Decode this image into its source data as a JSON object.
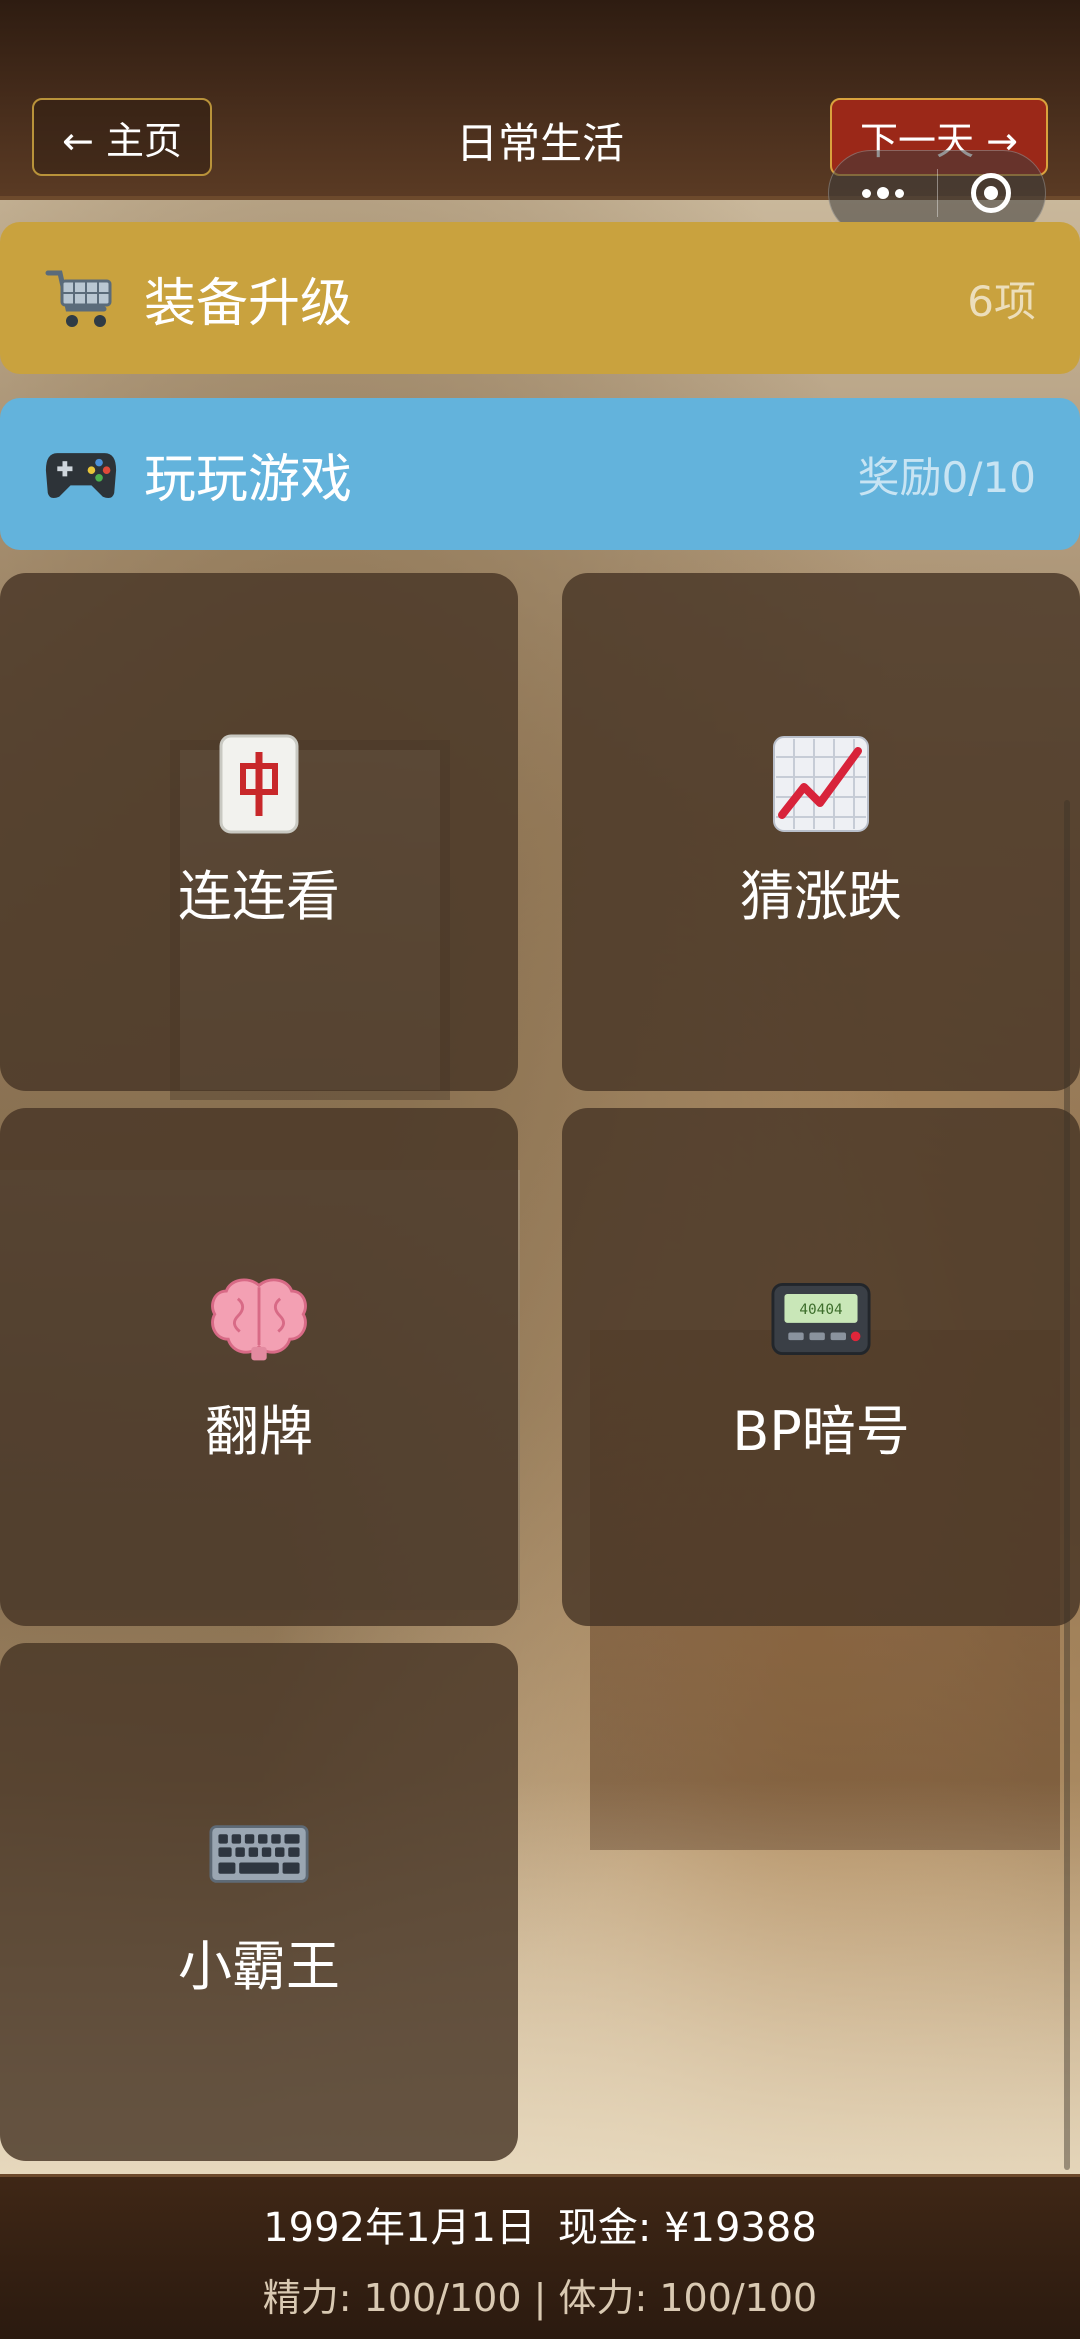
{
  "header": {
    "home_label": "← 主页",
    "title": "日常生活",
    "next_label": "下一天 →"
  },
  "banners": {
    "equip": {
      "label": "装备升级",
      "meta": "6项",
      "icon": "shopping-cart-icon"
    },
    "games": {
      "label": "玩玩游戏",
      "meta": "奖励0/10",
      "icon": "gamepad-icon"
    }
  },
  "tiles": [
    {
      "label": "连连看",
      "icon": "mahjong-tile-icon"
    },
    {
      "label": "猜涨跌",
      "icon": "chart-up-icon"
    },
    {
      "label": "翻牌",
      "icon": "brain-icon"
    },
    {
      "label": "BP暗号",
      "icon": "pager-icon",
      "pager_text": "40404"
    },
    {
      "label": "小霸王",
      "icon": "keyboard-icon"
    }
  ],
  "status": {
    "date": "1992年1月1日",
    "cash": "现金: ¥19388",
    "stats": "精力: 100/100 | 体力: 100/100"
  },
  "colors": {
    "equip_banner": "#c9a23e",
    "games_banner": "#63b3dc",
    "next_button": "#9b2818",
    "tile_bg": "#483626"
  }
}
